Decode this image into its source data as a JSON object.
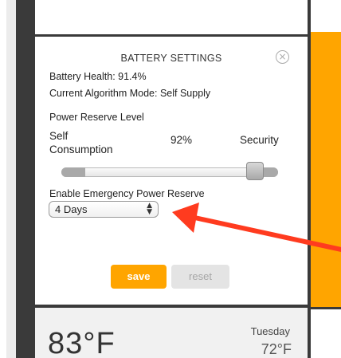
{
  "settings": {
    "title": "BATTERY SETTINGS",
    "battery_health": "Battery Health: 91.4%",
    "algorithm_mode": "Current Algorithm Mode: Self Supply",
    "power_reserve_label": "Power Reserve Level",
    "slider": {
      "left_label_line1": "Self",
      "left_label_line2": "Consumption",
      "value_label": "92%",
      "right_label": "Security",
      "value": 0.92
    },
    "emergency_label": "Enable Emergency Power Reserve",
    "emergency_select": {
      "selected": "4 Days"
    },
    "save_label": "save",
    "reset_label": "reset"
  },
  "weather": {
    "temperature": "83°F",
    "day": "Tuesday",
    "low": "72°F"
  },
  "icons": {
    "close": "close-icon",
    "select_arrows": "updown-arrows-icon",
    "annotation": "red-arrow-annotation"
  },
  "colors": {
    "accent": "#ffa500",
    "dark": "#3a3a3a",
    "annotation": "#ff3b1f"
  }
}
